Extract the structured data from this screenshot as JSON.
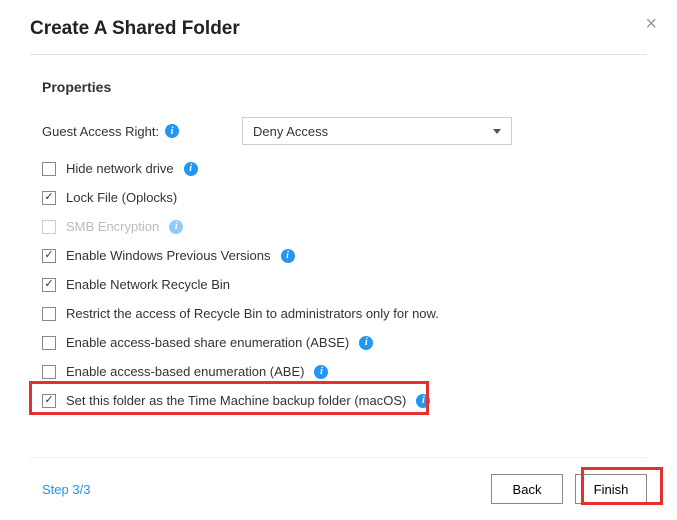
{
  "dialog": {
    "title": "Create A Shared Folder",
    "close_label": "×"
  },
  "section": {
    "title": "Properties"
  },
  "guest_access": {
    "label": "Guest Access Right:",
    "selected": "Deny Access"
  },
  "options": [
    {
      "label": "Hide network drive",
      "checked": false,
      "disabled": false,
      "has_info": true
    },
    {
      "label": "Lock File (Oplocks)",
      "checked": true,
      "disabled": false,
      "has_info": false
    },
    {
      "label": "SMB Encryption",
      "checked": false,
      "disabled": true,
      "has_info": true
    },
    {
      "label": "Enable Windows Previous Versions",
      "checked": true,
      "disabled": false,
      "has_info": true
    },
    {
      "label": "Enable Network Recycle Bin",
      "checked": true,
      "disabled": false,
      "has_info": false
    },
    {
      "label": "Restrict the access of Recycle Bin to administrators only for now.",
      "checked": false,
      "disabled": false,
      "has_info": false
    },
    {
      "label": "Enable access-based share enumeration (ABSE)",
      "checked": false,
      "disabled": false,
      "has_info": true
    },
    {
      "label": "Enable access-based enumeration (ABE)",
      "checked": false,
      "disabled": false,
      "has_info": true
    },
    {
      "label": "Set this folder as the Time Machine backup folder (macOS)",
      "checked": true,
      "disabled": false,
      "has_info": true
    }
  ],
  "footer": {
    "step": "Step 3/3",
    "back": "Back",
    "finish": "Finish"
  },
  "info_glyph": "i"
}
